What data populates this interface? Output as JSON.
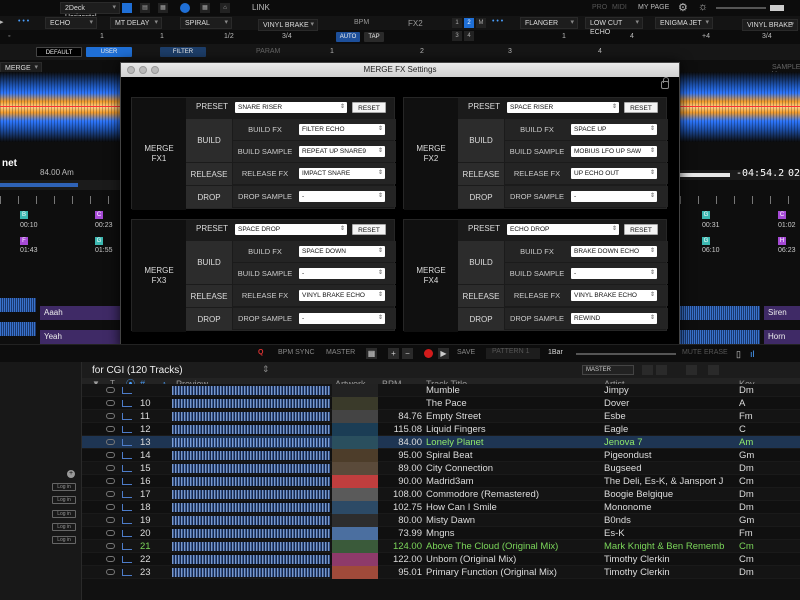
{
  "topbar": {
    "row1": {
      "deck_mode": "2Deck Horizontal",
      "link": "LINK",
      "right_labels": [
        "PRO",
        "MIDI",
        "MY PAGE"
      ]
    },
    "row2": {
      "fx1_slots": [
        "ECHO",
        "MT DELAY",
        "SPIRAL"
      ],
      "fx1_brake": "VINYL BRAKE",
      "bpm_label": "BPM",
      "fx2_label": "FX2",
      "fx2_slots": [
        "FLANGER",
        "LOW CUT ECHO",
        "ENIGMA JET",
        "VINYL BRAKE"
      ],
      "fx_assign_1": "1",
      "fx_assign_2": "2",
      "fx_assign_3": "3",
      "fx_assign_4": "4",
      "fx_assign_m": "M"
    },
    "row3": {
      "fx1_beats": [
        "1",
        "1",
        "1/2",
        "3/4"
      ],
      "auto": "AUTO",
      "tap": "TAP",
      "fx2_beats": [
        "1",
        "4",
        "+4",
        "3/4"
      ]
    },
    "row4": {
      "default": "DEFAULT",
      "user": "USER",
      "filter": "FILTER",
      "param": "PARAM",
      "param_numbers": [
        "1",
        "2",
        "3",
        "4"
      ]
    }
  },
  "decks": {
    "left": {
      "merge_fx": "MERGE FX 1",
      "title": "net",
      "bpm_key": "84.00 Am",
      "hotcues": [
        {
          "letter": "B",
          "color": "#3cb8b1",
          "time": "00:10"
        },
        {
          "letter": "C",
          "color": "#a64ad6",
          "time": "00:23"
        },
        {
          "letter": "F",
          "color": "#a64ad6",
          "time": "01:43"
        },
        {
          "letter": "G",
          "color": "#3cb8b1",
          "time": "01:55"
        }
      ],
      "pads": [
        "Aaah",
        "Yeah"
      ]
    },
    "right": {
      "sample": "SAMPLE V",
      "time": "-04:54.2",
      "time2": "02:5",
      "hotcues": [
        {
          "letter": "G",
          "color": "#3cb8b1",
          "time": "00:31"
        },
        {
          "letter": "C",
          "color": "#a64ad6",
          "time": "01:02"
        },
        {
          "letter": "G",
          "color": "#3cb8b1",
          "time": "06:10"
        },
        {
          "letter": "H",
          "color": "#a64ad6",
          "time": "06:23"
        }
      ],
      "pads": [
        "Siren",
        "Horn"
      ]
    }
  },
  "dialog": {
    "title": "MERGE FX Settings",
    "preset_label": "PRESET",
    "reset_label": "RESET",
    "build_label": "BUILD",
    "release_label": "RELEASE",
    "drop_label": "DROP",
    "build_fx_label": "BUILD FX",
    "build_sample_label": "BUILD SAMPLE",
    "release_fx_label": "RELEASE FX",
    "drop_sample_label": "DROP SAMPLE",
    "panels": [
      {
        "name1": "MERGE",
        "name2": "FX1",
        "preset": "SNARE RISER",
        "build_fx": "FILTER ECHO",
        "build_sample": "REPEAT UP SNARE9",
        "release_fx": "IMPACT SNARE",
        "drop_sample": "-"
      },
      {
        "name1": "MERGE",
        "name2": "FX2",
        "preset": "SPACE RISER",
        "build_fx": "SPACE UP",
        "build_sample": "MOBIUS LFO UP SAW",
        "release_fx": "UP ECHO OUT",
        "drop_sample": "-"
      },
      {
        "name1": "MERGE",
        "name2": "FX3",
        "preset": "SPACE DROP",
        "build_fx": "SPACE DOWN",
        "build_sample": "-",
        "release_fx": "VINYL BRAKE ECHO",
        "drop_sample": "-"
      },
      {
        "name1": "MERGE",
        "name2": "FX4",
        "preset": "ECHO DROP",
        "build_fx": "BRAKE DOWN ECHO",
        "build_sample": "-",
        "release_fx": "VINYL BRAKE ECHO",
        "drop_sample": "REWIND"
      }
    ]
  },
  "midbar": {
    "q": "Q",
    "bpm_sync": "BPM SYNC",
    "master": "MASTER",
    "save": "SAVE",
    "pattern": "PATTERN 1",
    "bar": "1Bar",
    "mute": "MUTE",
    "erase": "ERASE"
  },
  "browser": {
    "playlist_title": "for CGI (120 Tracks)",
    "mode": "MASTER",
    "columns": [
      "#",
      "Preview",
      "Artwork",
      "BPM",
      "Track Title",
      "Artist",
      "Key"
    ],
    "login_labels": [
      "Log in",
      "Log in",
      "Log in",
      "Log in",
      "Log in"
    ],
    "rows": [
      {
        "num": "",
        "bpm": "",
        "title": "Mumble",
        "artist": "Jimpy",
        "key": "Dm",
        "art": "#222"
      },
      {
        "num": "10",
        "bpm": "",
        "title": "The Pace",
        "artist": "Dover",
        "key": "A",
        "art": "#3a3a2a"
      },
      {
        "num": "11",
        "bpm": "84.76",
        "title": "Empty Street",
        "artist": "Esbe",
        "key": "Fm",
        "art": "#444"
      },
      {
        "num": "12",
        "bpm": "115.08",
        "title": "Liquid Fingers",
        "artist": "Eagle",
        "key": "C",
        "art": "#1b3d55"
      },
      {
        "num": "13",
        "bpm": "84.00",
        "title": "Lonely Planet",
        "artist": "Jenova 7",
        "key": "Am",
        "art": "#2a4f5e"
      },
      {
        "num": "14",
        "bpm": "95.00",
        "title": "Spiral Beat",
        "artist": "Pigeondust",
        "key": "Gm",
        "art": "#4d3d2a"
      },
      {
        "num": "15",
        "bpm": "89.00",
        "title": "City Connection",
        "artist": "Bugseed",
        "key": "Dm",
        "art": "#5a4a3a"
      },
      {
        "num": "16",
        "bpm": "90.00",
        "title": "Madrid3am",
        "artist": "The Deli, Es-K, & Jansport J",
        "key": "Cm",
        "art": "#c03e3e"
      },
      {
        "num": "17",
        "bpm": "108.00",
        "title": "Commodore (Remastered)",
        "artist": "Boogie Belgique",
        "key": "Dm",
        "art": "#5a5a5a"
      },
      {
        "num": "18",
        "bpm": "102.75",
        "title": "How Can I Smile",
        "artist": "Mononome",
        "key": "Dm",
        "art": "#2c4a66"
      },
      {
        "num": "19",
        "bpm": "80.00",
        "title": "Misty Dawn",
        "artist": "B0nds",
        "key": "Gm",
        "art": "#2d2d2d"
      },
      {
        "num": "20",
        "bpm": "73.99",
        "title": "Mngns",
        "artist": "Es-K",
        "key": "Fm",
        "art": "#4b6fa0"
      },
      {
        "num": "21",
        "bpm": "124.00",
        "title": "Above The Cloud (Original Mix)",
        "artist": "Mark Knight  & Ben Rememb",
        "key": "Cm",
        "art": "#3a5a3a"
      },
      {
        "num": "22",
        "bpm": "122.00",
        "title": "Unborn (Original Mix)",
        "artist": "Timothy Clerkin",
        "key": "Cm",
        "art": "#8e3a6a"
      },
      {
        "num": "23",
        "bpm": "95.01",
        "title": "Primary Function (Original Mix)",
        "artist": "Timothy Clerkin",
        "key": "Dm",
        "art": "#a04a3a"
      }
    ]
  }
}
